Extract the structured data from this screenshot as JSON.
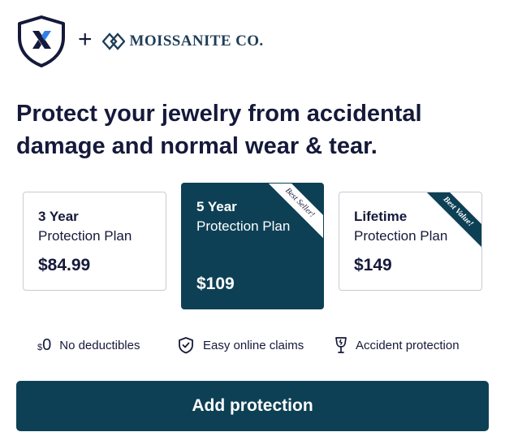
{
  "brand": {
    "plus_sign": "+",
    "partner_name": "MOISSANITE CO."
  },
  "headline": "Protect your jewelry from accidental damage and normal wear & tear.",
  "plans": [
    {
      "years": "3 Year",
      "type": "Protection Plan",
      "price": "$84.99",
      "badge": "",
      "selected": false
    },
    {
      "years": "5 Year",
      "type": "Protection Plan",
      "price": "$109",
      "badge": "Best Seller!",
      "selected": true
    },
    {
      "years": "Lifetime",
      "type": "Protection Plan",
      "price": "$149",
      "badge": "Best Value!",
      "selected": false
    }
  ],
  "features": [
    {
      "icon": "zero-dollar-icon",
      "prefix": "$",
      "zero": "0",
      "label": "No deductibles"
    },
    {
      "icon": "shield-check-icon",
      "label": "Easy online claims"
    },
    {
      "icon": "broken-glass-icon",
      "label": "Accident protection"
    }
  ],
  "cta": {
    "label": "Add protection"
  },
  "colors": {
    "primary": "#0d4055",
    "text": "#15193a",
    "border": "#c9cbd2",
    "logo_x": "#2f80e8"
  }
}
